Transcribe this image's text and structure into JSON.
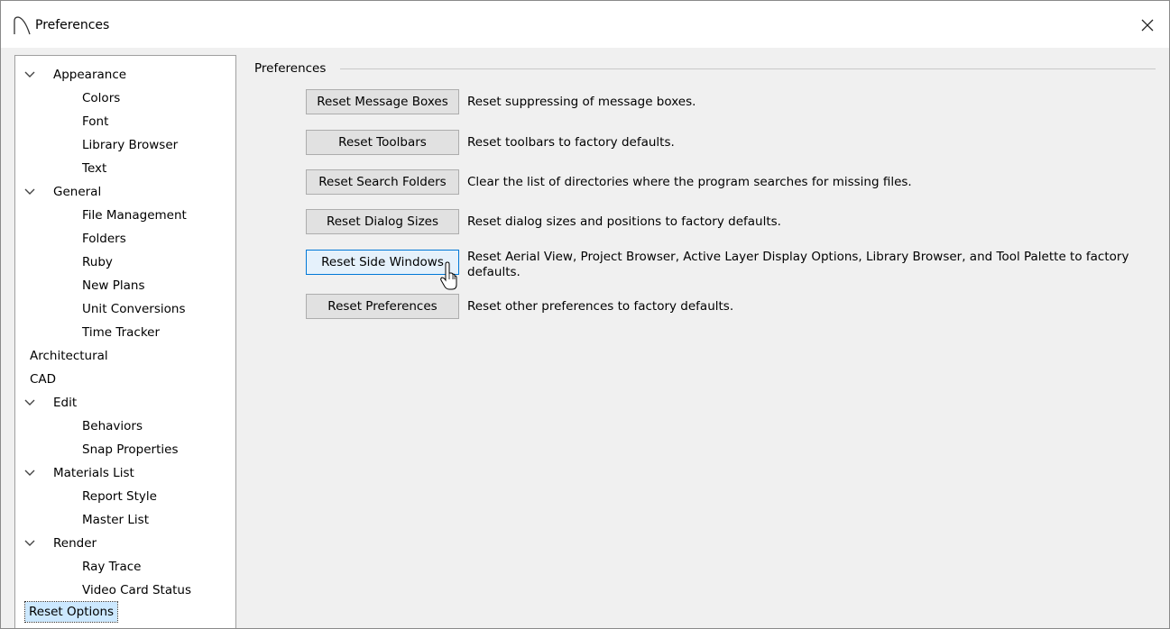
{
  "window": {
    "title": "Preferences",
    "close_icon": "close-icon"
  },
  "tree": {
    "items": [
      {
        "label": "Appearance",
        "expanded": true
      },
      {
        "label": "Colors"
      },
      {
        "label": "Font"
      },
      {
        "label": "Library Browser"
      },
      {
        "label": "Text"
      },
      {
        "label": "General",
        "expanded": true
      },
      {
        "label": "File Management"
      },
      {
        "label": "Folders"
      },
      {
        "label": "Ruby"
      },
      {
        "label": "New Plans"
      },
      {
        "label": "Unit Conversions"
      },
      {
        "label": "Time Tracker"
      },
      {
        "label": "Architectural"
      },
      {
        "label": "CAD"
      },
      {
        "label": "Edit",
        "expanded": true
      },
      {
        "label": "Behaviors"
      },
      {
        "label": "Snap Properties"
      },
      {
        "label": "Materials List",
        "expanded": true
      },
      {
        "label": "Report Style"
      },
      {
        "label": "Master List"
      },
      {
        "label": "Render",
        "expanded": true
      },
      {
        "label": "Ray Trace"
      },
      {
        "label": "Video Card Status"
      },
      {
        "label": "Reset Options",
        "selected": true
      }
    ]
  },
  "panel": {
    "group_label": "Preferences",
    "rows": [
      {
        "button": "Reset Message Boxes",
        "description": "Reset suppressing of message boxes."
      },
      {
        "button": "Reset Toolbars",
        "description": "Reset toolbars to factory defaults."
      },
      {
        "button": "Reset Search Folders",
        "description": "Clear the list of directories where the program searches for missing files."
      },
      {
        "button": "Reset Dialog Sizes",
        "description": "Reset dialog sizes and positions to factory defaults."
      },
      {
        "button": "Reset Side Windows",
        "description": "Reset Aerial View, Project Browser, Active Layer Display Options, Library Browser, and Tool Palette to factory defaults.",
        "hovered": true
      },
      {
        "button": "Reset Preferences",
        "description": "Reset other preferences to factory defaults."
      }
    ]
  },
  "colors": {
    "selection": "#cce8ff",
    "hover_border": "#0078d7",
    "button_face": "#e1e1e1",
    "dialog_bg": "#f0f0f0"
  }
}
